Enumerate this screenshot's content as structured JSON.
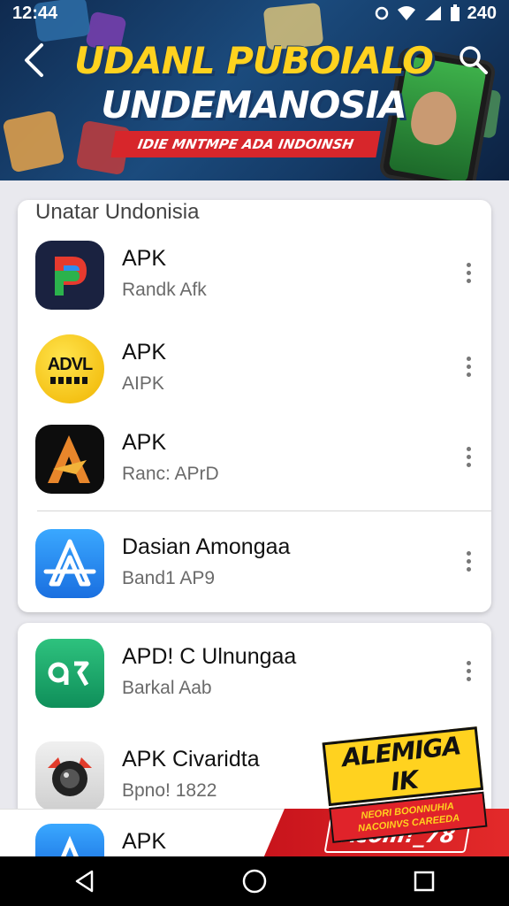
{
  "status_bar": {
    "time": "12:44",
    "battery": "240"
  },
  "banner": {
    "title_line1": "UDANL PUBOIALO",
    "title_line2": "UNDEMANOSIA",
    "ribbon_text": "IDIE MNTMPE ADA INDOINSH"
  },
  "section1": {
    "title": "Unatar Undonisia",
    "apps": [
      {
        "name": "APK",
        "subtitle": "Randk Afk",
        "icon": "p-logo-icon"
      },
      {
        "name": "APK",
        "subtitle": "AIPK",
        "icon": "adv-badge-icon",
        "icon_text": "ADVL"
      },
      {
        "name": "APK",
        "subtitle": "Ranc: APrD",
        "icon": "triangle-a-icon"
      },
      {
        "name": "Dasian Amongaa",
        "subtitle": "Band1 AP9",
        "icon": "app-store-a-icon"
      }
    ]
  },
  "section2": {
    "apps": [
      {
        "name": "APD! C Ulnungaa",
        "subtitle": "Barkal Aab",
        "icon": "green-apk-icon"
      },
      {
        "name": "APK Civaridta",
        "subtitle": "Bpno! 1822",
        "icon": "camera-lens-icon"
      },
      {
        "name": "APK",
        "subtitle": "",
        "icon": "blue-a-icon"
      }
    ]
  },
  "promo": {
    "badge_title": "ALEMIGA IK",
    "badge_sub": "NEORI BOONNUHIA NACOINVS CAREEDA",
    "button_label": "Acom!_78"
  },
  "colors": {
    "banner_title": "#ffd21f",
    "ribbon": "#d7262b",
    "promo": "#e32a2a"
  }
}
